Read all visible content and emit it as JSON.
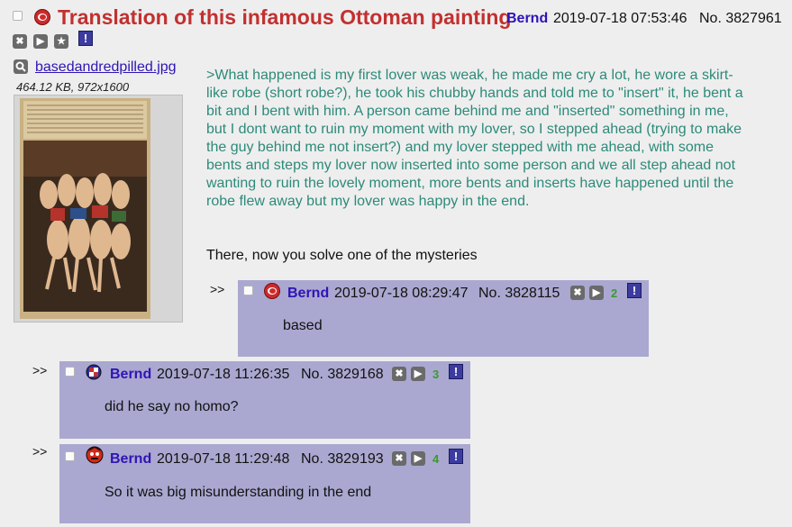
{
  "op": {
    "subject": "Translation of this infamous Ottoman painting",
    "name": "Bernd",
    "datetime": "2019-07-18 07:53:46",
    "number": "No. 3827961",
    "file": {
      "name": "basedandredpilled.jpg",
      "size": "464.12 KB, 972x1600"
    },
    "greentext": ">What happened is my first lover was weak, he made me cry a lot, he wore a skirt-like robe (short robe?), he took his chubby hands and told me to \"insert\" it, he bent a bit and I bent with him. A person came behind me and \"inserted\" something in me, but I dont want to ruin my moment with my lover, so I stepped ahead (trying to make the guy behind me not insert?) and my lover stepped with me ahead, with some bents and steps my lover now inserted into some person and we all step ahead not wanting to ruin the lovely moment, more bents and inserts have happened until the robe flew away but my lover was happy in the end.",
    "text": "There, now you solve one of the mysteries"
  },
  "replies": [
    {
      "arrows": ">>",
      "name": "Bernd",
      "datetime": "2019-07-18 08:29:47",
      "number": "No. 3828115",
      "count": "2",
      "body": "based"
    },
    {
      "arrows": ">>",
      "name": "Bernd",
      "datetime": "2019-07-18 11:26:35",
      "number": "No. 3829168",
      "count": "3",
      "body": "did he say no homo?"
    },
    {
      "arrows": ">>",
      "name": "Bernd",
      "datetime": "2019-07-18 11:29:48",
      "number": "No. 3829193",
      "count": "4",
      "body": "So it was big misunderstanding in the end"
    }
  ],
  "icons": {
    "hide": "✖",
    "play": "▶",
    "star": "★",
    "report": "!"
  },
  "colors": {
    "subject": "#c2302f",
    "name": "#2f14b5",
    "greentext": "#2d8a7a",
    "reply_bg": "#aaa8d0",
    "page_bg": "#eeeeee"
  }
}
